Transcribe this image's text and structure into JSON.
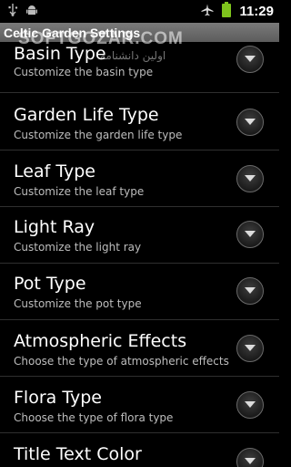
{
  "statusbar": {
    "time": "11:29",
    "icons": [
      "usb-icon",
      "android-debug-icon",
      "airplane-mode-icon",
      "battery-icon"
    ]
  },
  "titlebar": {
    "title": "Celtic Garden Settings"
  },
  "watermark": {
    "text": "SOFTGOZAR.COM",
    "subtext": "اولین دانشنامه"
  },
  "settings": [
    {
      "title": "Basin Type",
      "summary": "Customize the basin type"
    },
    {
      "title": "Garden Life Type",
      "summary": "Customize the garden life type"
    },
    {
      "title": "Leaf Type",
      "summary": "Customize the leaf type"
    },
    {
      "title": "Light Ray",
      "summary": "Customize the light ray"
    },
    {
      "title": "Pot Type",
      "summary": "Customize the pot type"
    },
    {
      "title": "Atmospheric Effects",
      "summary": "Choose the type of atmospheric effects"
    },
    {
      "title": "Flora Type",
      "summary": "Choose the type of flora type"
    },
    {
      "title": "Title Text Color",
      "summary": ""
    }
  ],
  "colors": {
    "background": "#000000",
    "titlebar": "#6b6b6b",
    "battery": "#7ec41d",
    "summary_text": "#bdbdbd"
  }
}
